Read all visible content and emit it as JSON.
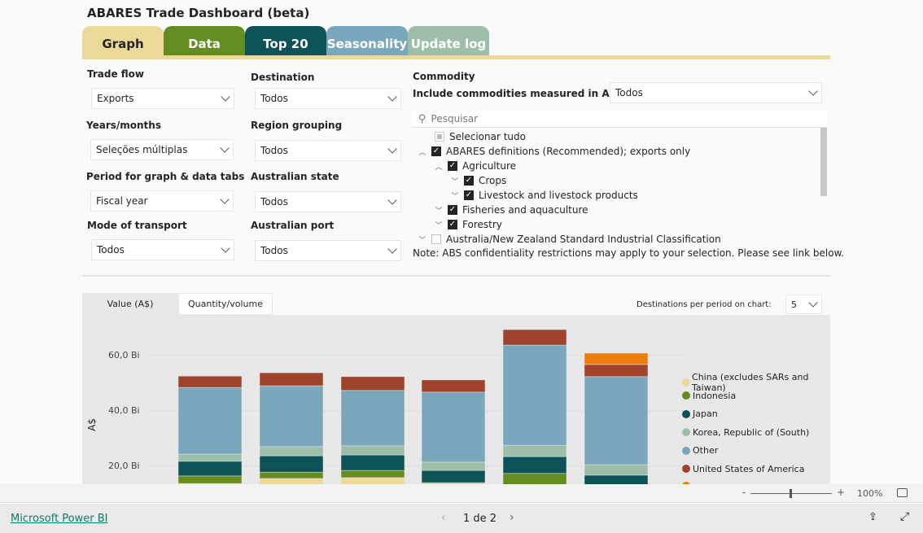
{
  "title": "ABARES Trade Dashboard (beta)",
  "tabs": [
    {
      "label": "Graph",
      "color": "#ecd898",
      "text": "#252423"
    },
    {
      "label": "Data",
      "color": "#648c1e"
    },
    {
      "label": "Top 20",
      "color": "#0d5257"
    },
    {
      "label": "Seasonality",
      "color": "#7ba7bc"
    },
    {
      "label": "Update log",
      "color": "#9dbfa9"
    }
  ],
  "filters": {
    "trade_flow": {
      "label": "Trade flow",
      "value": "Exports"
    },
    "years": {
      "label": "Years/months",
      "value": "Seleções múltiplas"
    },
    "period": {
      "label": "Period for graph & data tabs",
      "value": "Fiscal year"
    },
    "transport": {
      "label": "Mode of transport",
      "value": "Todos"
    },
    "destination": {
      "label": "Destination",
      "value": "Todos"
    },
    "region": {
      "label": "Region grouping",
      "value": "Todos"
    },
    "state": {
      "label": "Australian state",
      "value": "Todos"
    },
    "port": {
      "label": "Australian port",
      "value": "Todos"
    }
  },
  "commodity": {
    "label": "Commodity",
    "include_label": "Include commodities measured in A$ and:",
    "include_value": "Todos",
    "search_placeholder": "Pesquisar",
    "items": [
      "Selecionar tudo",
      "ABARES definitions (Recommended); exports only",
      "Agriculture",
      "Crops",
      "Livestock and livestock products",
      "Fisheries and aquaculture",
      "Forestry",
      "Australia/New Zealand Standard Industrial Classification"
    ],
    "note": "Note: ABS confidentiality restrictions may apply to your selection. Please see link below."
  },
  "chart_tabs": [
    "Value (A$)",
    "Quantity/volume"
  ],
  "dest_per_period": {
    "label": "Destinations per period on chart:",
    "value": "5"
  },
  "chart_data": {
    "type": "bar",
    "stacked": true,
    "ylabel": "A$",
    "yticks": [
      "20,0 Bi",
      "40,0 Bi",
      "60,0 Bi"
    ],
    "ytick_values": [
      20,
      40,
      60
    ],
    "grid": true,
    "legend": "right",
    "series": [
      {
        "name": "China (excludes SARs and Taiwan)",
        "color": "#ecd898",
        "values": [
          13.8,
          15.6,
          15.9,
          13.8,
          13.0,
          8.0
        ]
      },
      {
        "name": "Indonesia",
        "color": "#648c1e",
        "values": [
          2.7,
          2.3,
          2.6,
          0.3,
          4.4,
          4.0
        ]
      },
      {
        "name": "Japan",
        "color": "#0d5257",
        "values": [
          5.3,
          5.9,
          5.6,
          4.4,
          6.1,
          4.8
        ]
      },
      {
        "name": "Korea, Republic of (South)",
        "color": "#9dbfa9",
        "values": [
          2.6,
          3.3,
          3.3,
          3.0,
          4.1,
          3.8
        ]
      },
      {
        "name": "Other",
        "color": "#7ba7bc",
        "values": [
          24.1,
          22.0,
          20.0,
          25.3,
          36.2,
          31.8
        ]
      },
      {
        "name": "United States of America",
        "color": "#a0432d",
        "values": [
          4.1,
          4.7,
          5.0,
          4.4,
          5.6,
          4.4
        ]
      },
      {
        "color": "#ed7d0a",
        "values": [
          0,
          0,
          0,
          0,
          0,
          4.1
        ]
      }
    ]
  },
  "zoom": {
    "value": "100%"
  },
  "footer": {
    "brand": "Microsoft Power BI",
    "page": "1 de 2"
  }
}
